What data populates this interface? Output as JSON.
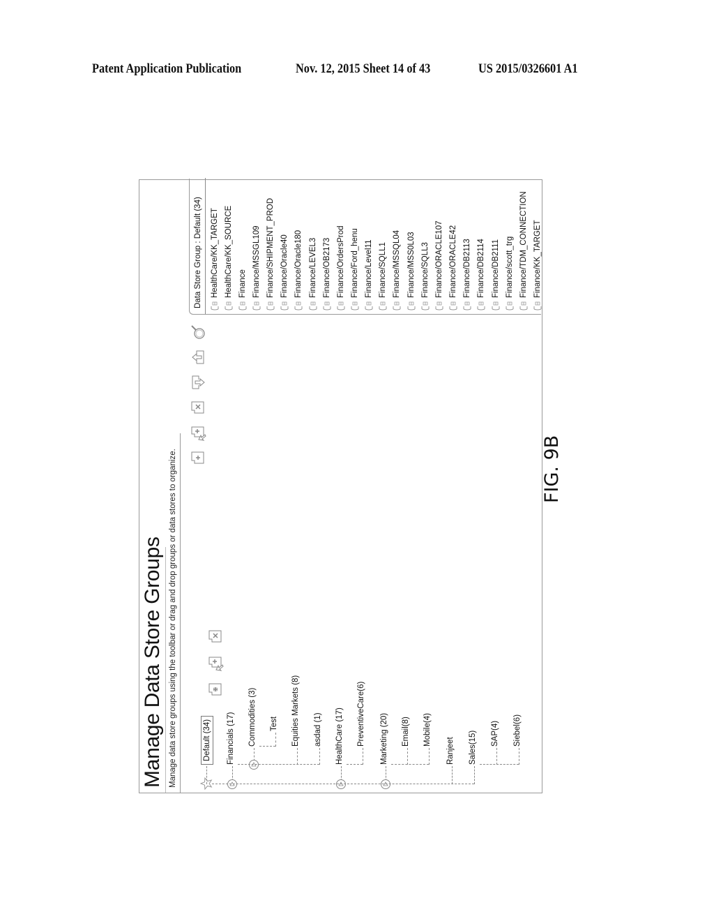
{
  "header": {
    "left": "Patent Application Publication",
    "middle": "Nov. 12, 2015  Sheet 14 of 43",
    "right": "US 2015/0326601 A1"
  },
  "app": {
    "title": "Manage Data Store Groups",
    "subtitle": "Manage data store groups using the toolbar or drag and drop groups or data stores to organize."
  },
  "tree_toolbar": [
    {
      "name": "add-group-icon",
      "label": "Add group"
    },
    {
      "name": "add-subgroup-icon",
      "label": "Add subgroup"
    },
    {
      "name": "delete-group-icon",
      "label": "Delete group"
    }
  ],
  "tree": {
    "nodes": [
      {
        "label": "Default (34)",
        "level": 0,
        "selected": true,
        "icon": "star-icon"
      },
      {
        "label": "Financials (17)",
        "level": 0,
        "expandable": true
      },
      {
        "label": "Commodities (3)",
        "level": 1,
        "expandable": true
      },
      {
        "label": "Test",
        "level": 2
      },
      {
        "label": "Equities Markets (8)",
        "level": 1
      },
      {
        "label": "asdad (1)",
        "level": 1
      },
      {
        "label": "HealthCare (17)",
        "level": 0,
        "expandable": true
      },
      {
        "label": "PreventiveCare(6)",
        "level": 1
      },
      {
        "label": "Marketing (20)",
        "level": 0,
        "expandable": true
      },
      {
        "label": "Email(8)",
        "level": 1
      },
      {
        "label": "Mobile(4)",
        "level": 1
      },
      {
        "label": "Ranjeet",
        "level": 0
      },
      {
        "label": "Sales(15)",
        "level": 0
      },
      {
        "label": "SAP(4)",
        "level": 1
      },
      {
        "label": "Siebel(6)",
        "level": 1
      }
    ]
  },
  "toolbar": [
    {
      "name": "add-datastore-icon",
      "label": "Add data store"
    },
    {
      "name": "add-datastore-wizard-icon",
      "label": "Add data store wizard"
    },
    {
      "name": "delete-datastore-icon",
      "label": "Delete data store"
    },
    {
      "name": "import-icon",
      "label": "Import"
    },
    {
      "name": "export-icon",
      "label": "Export"
    },
    {
      "name": "search-icon",
      "label": "Search"
    }
  ],
  "datastores": {
    "header": "Data Store Group : Default (34)",
    "items": [
      "HealthCare/KK_TARGET",
      "HealthCare/KK_SOURCE",
      "Finance",
      "Finance/MSSGL109",
      "Finance/SHIPMENT_PROD",
      "Finance/Oracle40",
      "Finance/Oracle180",
      "Finance/LEVEL3",
      "Finance/OB2173",
      "Finance/OrdersProd",
      "Finance/Ford_henu",
      "Finance/Level11",
      "Finance/SQLL1",
      "Finance/MSSQL04",
      "Finance/MSS0L03",
      "Finance/SQLL3",
      "Finance/ORACLE107",
      "Finance/ORACLE42",
      "Finance/DB2113",
      "Finance/DB2114",
      "Finance/DB2111",
      "Finance/scott_trg",
      "Finance/TDM_CONNECTION",
      "Finance/KK_TARGET"
    ]
  },
  "figure_label": "FIG. 9B"
}
